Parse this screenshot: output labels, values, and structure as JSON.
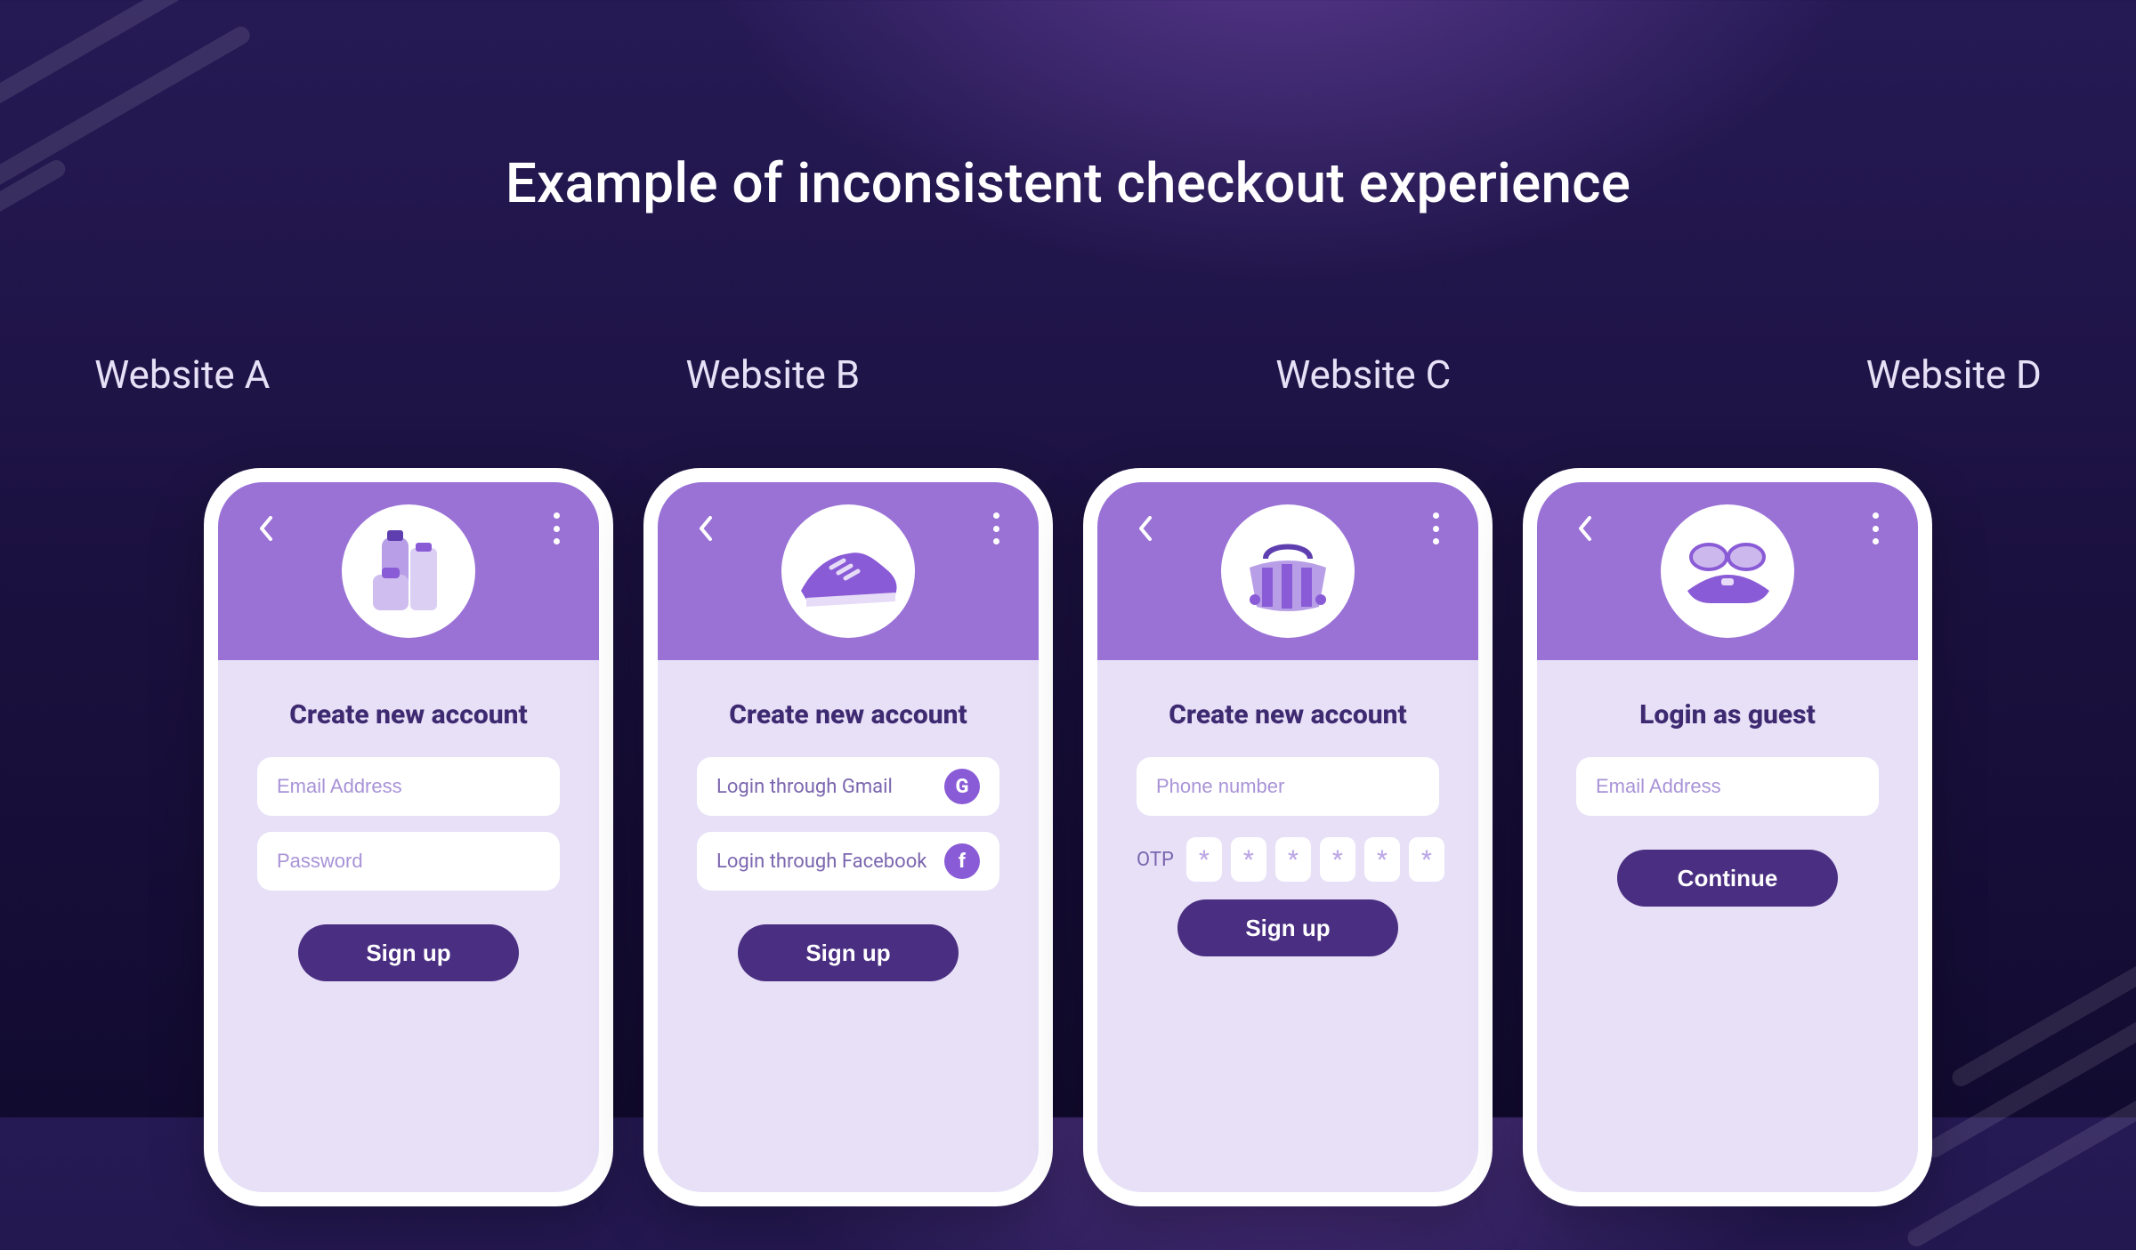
{
  "title": "Example of inconsistent checkout experience",
  "labels": [
    "Website A",
    "Website B",
    "Website C",
    "Website D"
  ],
  "common": {
    "otp_mask": "*"
  },
  "websites": {
    "A": {
      "heading": "Create new account",
      "email_placeholder": "Email Address",
      "password_placeholder": "Password",
      "cta": "Sign up"
    },
    "B": {
      "heading": "Create new account",
      "gmail_label": "Login through Gmail",
      "gmail_badge": "G",
      "facebook_label": "Login through Facebook",
      "facebook_badge": "f",
      "cta": "Sign up"
    },
    "C": {
      "heading": "Create new account",
      "phone_placeholder": "Phone number",
      "otp_label": "OTP",
      "otp_count": 6,
      "cta": "Sign up"
    },
    "D": {
      "heading": "Login as guest",
      "email_placeholder": "Email Address",
      "cta": "Continue"
    }
  }
}
